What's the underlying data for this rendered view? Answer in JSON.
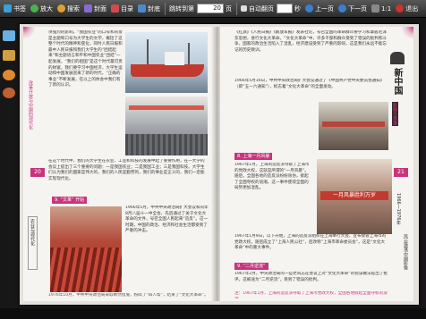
{
  "toolbar": {
    "bookmark": "书签",
    "zoom_in": "放大",
    "search": "搜索",
    "cover": "封面",
    "toc": "目录",
    "back_cover": "封底",
    "goto_label": "跳转到第",
    "page_value": "20",
    "page_suffix": "页",
    "auto_flip": "自动翻页",
    "sec_value": "",
    "sec_suffix": "秒",
    "prev": "上一页",
    "next": "下一页",
    "ratio": "1:1",
    "exit": "退出",
    "search_value": ""
  },
  "colors": {
    "accent": "#c8347c",
    "photo_red": "#b84433",
    "photo_blue": "#8ea4b8"
  },
  "left_page": {
    "page_number": "20",
    "side_tab": "农业与现代化",
    "side_vertical": "改革开放与中国的现代化",
    "para1": "项强烈的影响。“我国农业”的口号和背景是主题和口号为大学生的文学，概括了这整个时代的精神和变化，同时人民日报和最中人民日报和我们大学生的“团结起来”和主题语言和平和中国农业“团结”一起发展，“我们的祖国”是这个时代最可贵的财富，我们要学习中国经济，大学生运动和中国发展迎来了新的时代，“正确的事业”不断发展，在以上的体会中我们有了新的认识。",
    "para2": "在这个时代中，我们的大学生在农业、工业和科技的发展中起了重要作用，在一大学的会议上提出了三个重要的问题：一是我国农业；二是我国工业；三是我国科技。大学生们认为我们的国家是伟大的，我们的人民是勤劳的，我们的事业是正义的，我们一定能实现现代化。",
    "para3": "1983年5月，我国农村改革全面展开，农民群众的积极性空前高涨，生产力得到了极大的解放。在这个过程中，全国的农业生产迅速发展，粮食产量大幅增长，人民的生活水平得到了明显的提高。",
    "section_title": "9. “文革” 开始",
    "para4": "1966年5月，中共中央政治局扩大会议和同年8月八届十一中全会，先后通过了关于文化大革命的文件，号召全国人民起来“造反”。这一时期，中国的政治、经济和社会生活都受到了严重的冲击。",
    "para5": "这一时期的历史经验告诉我们，必须坚持实事求是的思想路线，必须坚持以经济建设为中心，必须坚持改革开放。",
    "footnote": "1976年10月，中共中央政治局采取断然措施，粉碎了“四人帮”，结束了“文化大革命”。"
  },
  "right_page": {
    "page_number": "21",
    "masthead_title": "新中国",
    "masthead_sub": "影像大事录",
    "side_years": "1966—1976年",
    "side_vertical": "风云激荡中国影像",
    "para1": "《红旗》《人民日报》《解放军报》发表社论，号召全国的革命群众要学习和掌握毛泽东思想，进行文化大革命。“文化大革命”中，许多干部和群众受到了错误的批判和斗争，国家的政治生活陷入了混乱，经济建设受到了严重的影响，这是我们永远不能忘记的历史教训。",
    "para2": "1966年5月16日，中共中央政治局扩大会议通过了《中国共产党中央委员会通知》（即“五一六通知”），标志着“文化大革命”的全面发动。",
    "section1": "8. 上海一月风暴",
    "para3": "1967年1月，上海的造反派夺取了上海市的党政大权，这就是所谓的“一月风暴”。随后，全国各地的造反派纷纷效仿，掀起了全面夺权的浪潮。这一事件使得全国的局势更加混乱。",
    "banner_text": "一月风暴胜利万岁",
    "para4": "1967年1月9日，以下开始，上海的造反派组织在上海举行大会，宣布接管上海市的党政大权，随后成立了“上海人民公社”，后改称“上海市革命委员会”。这是“文化大革命”中的重大事件。",
    "section2": "9. “二月逆流”",
    "para5": "1967年2月，中央政治局的一些老同志在会议上对“文化大革命”的错误做法提出了批评，这被诬为“二月逆流”，受到了错误的批判。",
    "footnote": "注：1967年1月，上海的造反派夺取了上海市党政大权，全国各地掀起全面夺权的浪潮。"
  },
  "captions": {
    "left_top": "",
    "left_bottom": "",
    "right_top": "",
    "right_mid": ""
  }
}
